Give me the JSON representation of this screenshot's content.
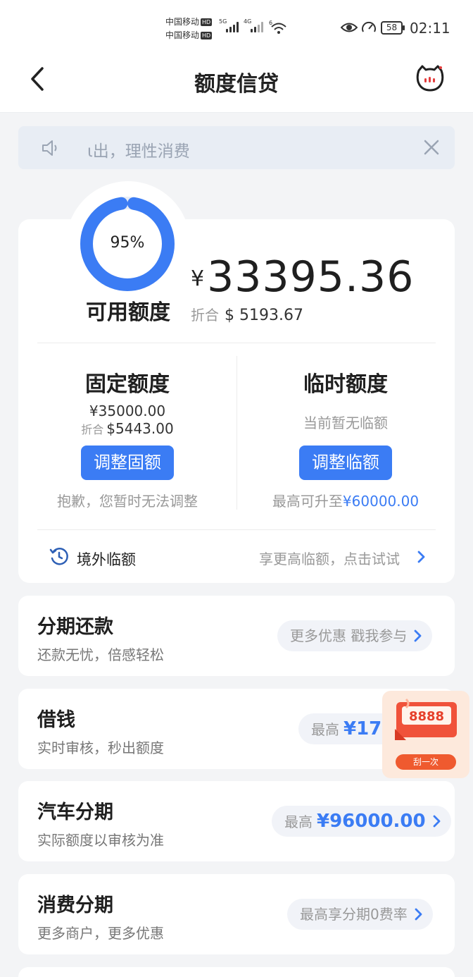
{
  "status_bar": {
    "carrier_1": "中国移动",
    "carrier_2": "中国移动",
    "hd_badge": "HD",
    "net_1": "5G",
    "net_2": "4G",
    "net_3": "6",
    "battery": "58",
    "time": "02:11",
    "icons": [
      "wifi-icon",
      "eye-icon",
      "speedometer-icon"
    ]
  },
  "header": {
    "title": "额度信贷",
    "back_icon": "chevron-left-icon",
    "service_icon": "cat-service-icon"
  },
  "notice": {
    "text": "ι出，理性消费",
    "icon": "speaker-icon",
    "close_icon": "close-icon"
  },
  "credit": {
    "ring_percent": 0.95,
    "ring_label": "95%",
    "available_label": "可用额度",
    "currency_symbol": "¥",
    "available_amount": "33395.36",
    "usd_prefix": "折合",
    "usd_amount": "$ 5193.67",
    "ring_color": "#3b7cf4",
    "fixed": {
      "title": "固定额度",
      "amount": "¥35000.00",
      "usd_prefix": "折合",
      "usd_amount": "$5443.00",
      "button": "调整固额",
      "note": "抱歉，您暂时无法调整"
    },
    "temporary": {
      "title": "临时额度",
      "note": "当前暂无临额",
      "button": "调整临额",
      "max_prefix": "最高可升至",
      "max_amount": "¥60000.00"
    },
    "overseas": {
      "label": "境外临额",
      "link": "享更高临额，点击试试"
    }
  },
  "services": [
    {
      "title": "分期还款",
      "subtitle": "还款无忧，倍感轻松",
      "pill_text": "更多优惠 戳我参与",
      "pill_amount": ""
    },
    {
      "title": "借钱",
      "subtitle": "实时审核，秒出额度",
      "pill_text": "最高",
      "pill_amount": "¥175"
    },
    {
      "title": "汽车分期",
      "subtitle": "实际额度以审核为准",
      "pill_text": "最高",
      "pill_amount": "¥96000.00"
    },
    {
      "title": "消费分期",
      "subtitle": "更多商户，更多优惠",
      "pill_text": "最高享分期0费率",
      "pill_amount": ""
    }
  ],
  "scratch": {
    "ticket_text": "8888",
    "button": "刮一次"
  },
  "colors": {
    "accent": "#3b7cf4",
    "background": "#f3f4f6",
    "scratch_red": "#ef5a2f"
  }
}
